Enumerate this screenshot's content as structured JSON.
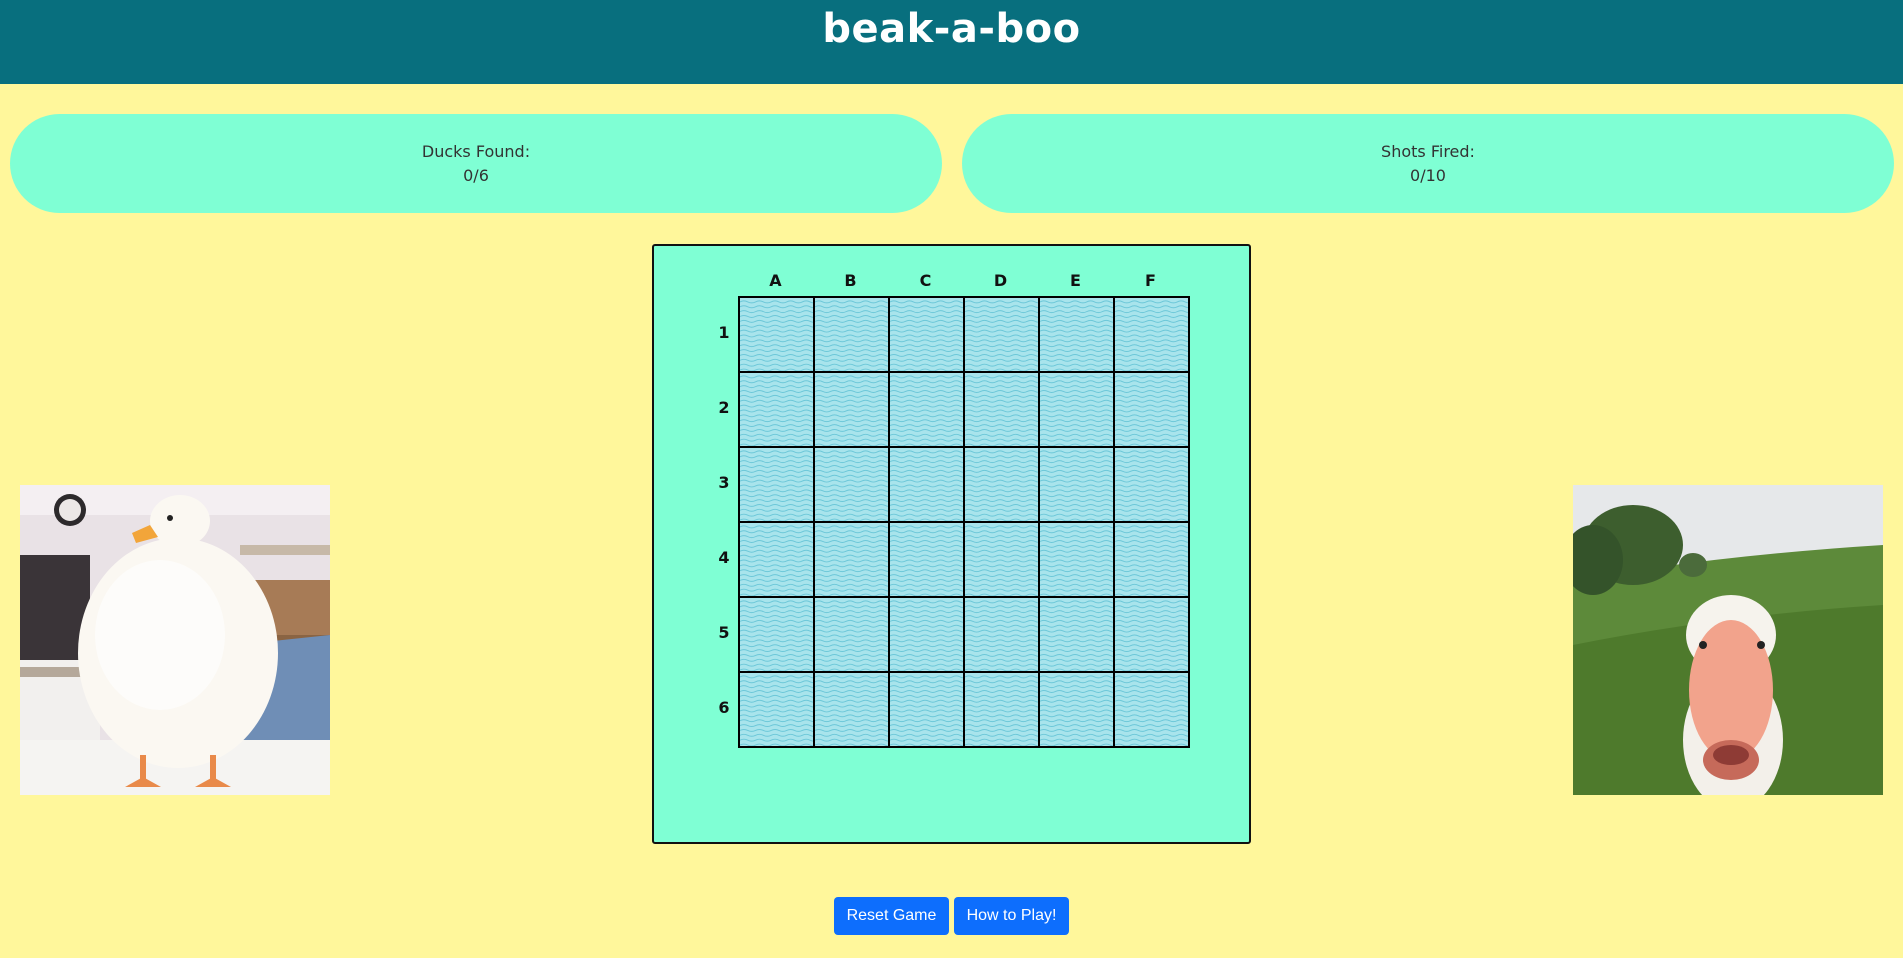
{
  "header": {
    "title": "beak-a-boo"
  },
  "stats": {
    "ducks_label": "Ducks Found:",
    "ducks_value": "0/6",
    "shots_label": "Shots Fired:",
    "shots_value": "0/10"
  },
  "board": {
    "columns": [
      "A",
      "B",
      "C",
      "D",
      "E",
      "F"
    ],
    "rows": [
      "1",
      "2",
      "3",
      "4",
      "5",
      "6"
    ],
    "cell_state": "water"
  },
  "buttons": {
    "reset_label": "Reset Game",
    "howto_label": "How to Play!"
  },
  "colors": {
    "header_bg": "#086f7e",
    "page_bg": "#fff79b",
    "panel_bg": "#7fffd4",
    "water": "#a8e4ec",
    "button": "#0d6efd"
  }
}
